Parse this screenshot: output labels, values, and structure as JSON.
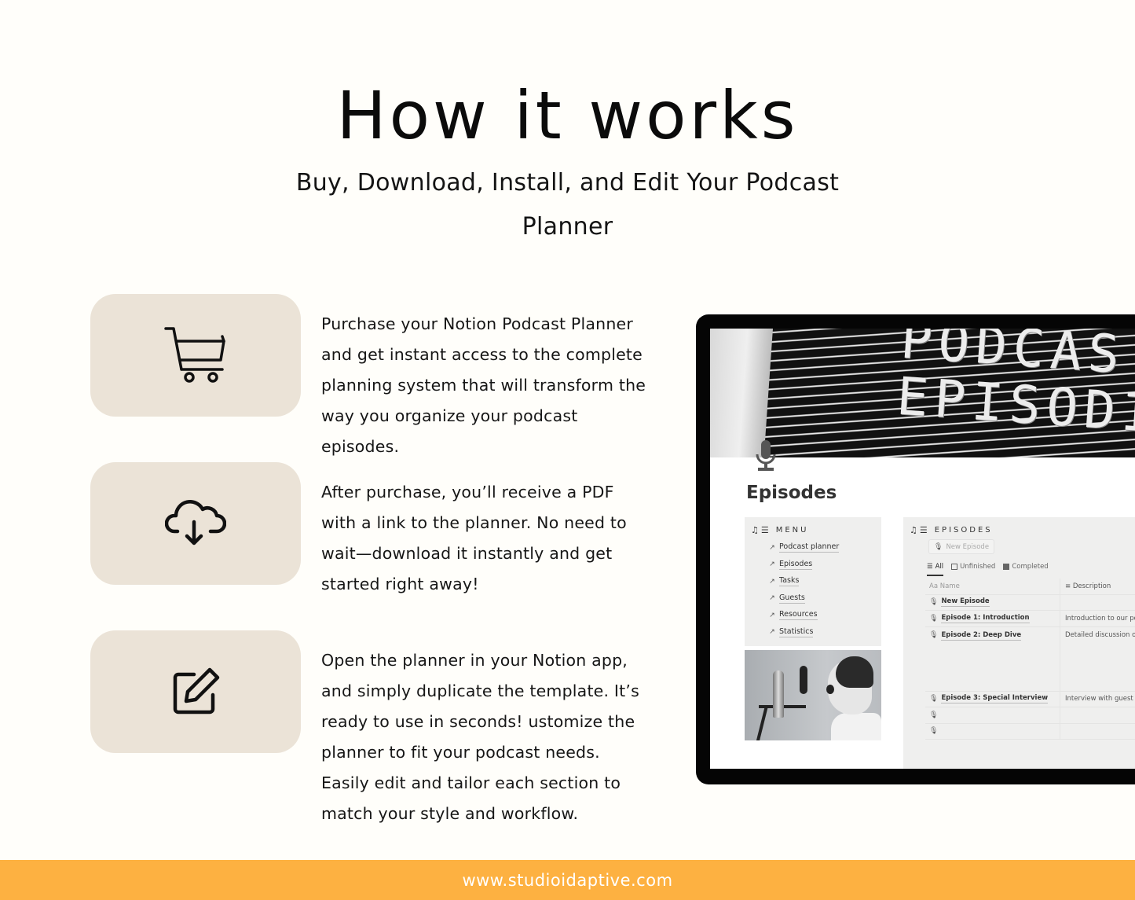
{
  "header": {
    "title": "How it works",
    "subtitle_line1": "Buy, Download, Install, and Edit Your Podcast",
    "subtitle_line2": "Planner"
  },
  "steps": [
    {
      "icon": "shopping-cart-icon",
      "text": "Purchase your Notion Podcast Planner and get instant access to the complete planning system that will transform the way you organize your podcast episodes."
    },
    {
      "icon": "cloud-download-icon",
      "text": "After purchase, you’ll receive a PDF with a link to the planner. No need to wait—download it instantly and get started right away!"
    },
    {
      "icon": "edit-icon",
      "text": "Open the planner in your Notion app, and simply duplicate the template. It’s ready to use in seconds! ustomize the planner to fit your podcast needs. Easily edit and tailor each section to match your style and workflow."
    }
  ],
  "preview": {
    "cover_text_line1": "PODCAS",
    "cover_text_line2": "EPISODI",
    "page_title": "Episodes",
    "menu": {
      "heading": "MENU",
      "items": [
        "Podcast planner",
        "Episodes",
        "Tasks",
        "Guests",
        "Resources",
        "Statistics"
      ]
    },
    "episodes": {
      "heading": "EPISODES",
      "new_button": "New Episode",
      "tabs": [
        "All",
        "Unfinished",
        "Completed"
      ],
      "columns": [
        "Aa Name",
        "Description"
      ],
      "rows": [
        {
          "name": "New Episode",
          "description": ""
        },
        {
          "name": "Episode 1: Introduction",
          "description": "Introduction to our poc"
        },
        {
          "name": "Episode 2: Deep Dive",
          "description": "Detailed discussion on t"
        },
        {
          "name": "Episode 3: Special Interview",
          "description": "Interview with guest Y"
        },
        {
          "name": "",
          "description": ""
        },
        {
          "name": "",
          "description": ""
        }
      ]
    }
  },
  "footer": {
    "url": "www.studioidaptive.com"
  },
  "colors": {
    "accent": "#fdb141",
    "card": "#ebe3d7",
    "background": "#fffefa"
  }
}
